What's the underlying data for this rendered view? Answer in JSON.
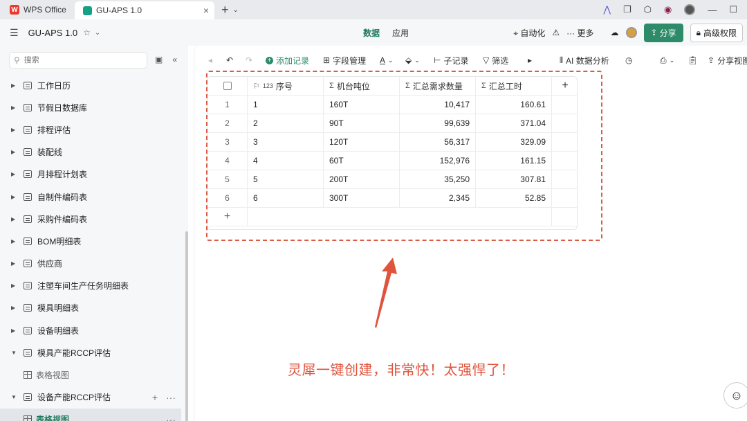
{
  "window": {
    "tabs": [
      {
        "label": "WPS Office",
        "logo": "W"
      },
      {
        "label": "GU-APS 1.0"
      }
    ]
  },
  "appbar": {
    "doc_title": "GU-APS 1.0",
    "tabs": [
      "数据",
      "应用"
    ],
    "automation": "自动化",
    "more": "更多",
    "share": "分享",
    "permission": "高级权限"
  },
  "sidebar": {
    "search_placeholder": "搜索",
    "items": [
      {
        "label": "工作日历"
      },
      {
        "label": "节假日数据库"
      },
      {
        "label": "排程评估"
      },
      {
        "label": "装配线"
      },
      {
        "label": "月排程计划表"
      },
      {
        "label": "自制件编码表"
      },
      {
        "label": "采购件编码表"
      },
      {
        "label": "BOM明细表"
      },
      {
        "label": "供应商"
      },
      {
        "label": "注塑车间生产任务明细表"
      },
      {
        "label": "模具明细表"
      },
      {
        "label": "设备明细表"
      },
      {
        "label": "模具产能RCCP评估"
      },
      {
        "label": "表格视图"
      },
      {
        "label": "设备产能RCCP评估"
      },
      {
        "label": "表格视图"
      }
    ]
  },
  "toolbar": {
    "add_record": "添加记录",
    "field_manage": "字段管理",
    "sub_record": "子记录",
    "filter": "筛选",
    "ai_analysis": "AI 数据分析",
    "share_view": "分享视图"
  },
  "table": {
    "columns": [
      {
        "type": "123",
        "label": "序号"
      },
      {
        "type": "Σ",
        "label": "机台吨位"
      },
      {
        "type": "Σ",
        "label": "汇总需求数量"
      },
      {
        "type": "Σ",
        "label": "汇总工时"
      }
    ],
    "rows": [
      {
        "idx": "1",
        "seq": "1",
        "tonnage": "160T",
        "qty": "10,417",
        "hours": "160.61"
      },
      {
        "idx": "2",
        "seq": "2",
        "tonnage": "90T",
        "qty": "99,639",
        "hours": "371.04"
      },
      {
        "idx": "3",
        "seq": "3",
        "tonnage": "120T",
        "qty": "56,317",
        "hours": "329.09"
      },
      {
        "idx": "4",
        "seq": "4",
        "tonnage": "60T",
        "qty": "152,976",
        "hours": "161.15"
      },
      {
        "idx": "5",
        "seq": "5",
        "tonnage": "200T",
        "qty": "35,250",
        "hours": "307.81"
      },
      {
        "idx": "6",
        "seq": "6",
        "tonnage": "300T",
        "qty": "2,345",
        "hours": "52.85"
      }
    ]
  },
  "annotation": "灵犀一键创建，非常快！太强悍了！",
  "colors": {
    "accent": "#2e8b6a",
    "annotation": "#e0533c"
  }
}
